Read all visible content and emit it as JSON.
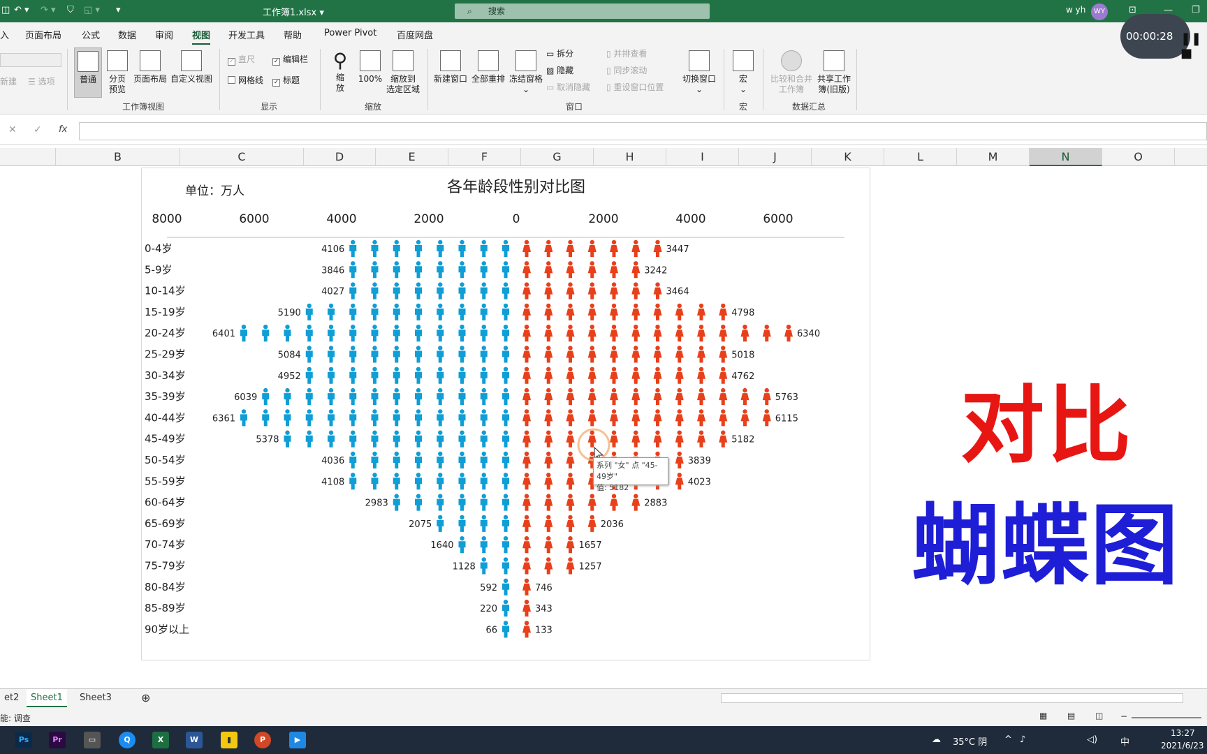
{
  "window": {
    "filename": "工作簿1.xlsx",
    "search_placeholder": "搜索",
    "user": "w yh",
    "avatar": "WY",
    "recording_time": "00:00:28"
  },
  "menu": [
    "入",
    "页面布局",
    "公式",
    "数据",
    "审阅",
    "视图",
    "开发工具",
    "帮助",
    "Power Pivot",
    "百度网盘"
  ],
  "ribbon": {
    "left_partial": [
      "新建",
      "选项"
    ],
    "workbook_views": {
      "label": "工作簿视图",
      "items": [
        "普通",
        "分页\n预览",
        "页面布局",
        "自定义视图"
      ]
    },
    "show": {
      "label": "显示",
      "ruler": "直尺",
      "gridlines": "网格线",
      "formula_bar": "编辑栏",
      "headings": "标题"
    },
    "zoom": {
      "label": "缩放",
      "items": [
        "缩\n放",
        "100%",
        "缩放到\n选定区域"
      ]
    },
    "window": {
      "label": "窗口",
      "items": [
        "新建窗口",
        "全部重排",
        "冻结窗格"
      ],
      "small": [
        "拆分",
        "隐藏",
        "取消隐藏",
        "并排查看",
        "同步滚动",
        "重设窗口位置"
      ],
      "switch": "切换窗口"
    },
    "macro": {
      "label": "宏",
      "item": "宏"
    },
    "summary": {
      "label": "数据汇总",
      "items": [
        "比较和合并\n工作簿",
        "共享工作\n簿(旧版)"
      ]
    }
  },
  "columns": [
    "B",
    "C",
    "D",
    "E",
    "F",
    "G",
    "H",
    "I",
    "J",
    "K",
    "L",
    "M",
    "N",
    "O"
  ],
  "selected_column": "N",
  "chart_data": {
    "type": "bar",
    "title": "各年龄段性别对比图",
    "unit_label": "单位：万人",
    "axis_ticks": [
      "8000",
      "6000",
      "4000",
      "2000",
      "0",
      "2000",
      "4000",
      "6000"
    ],
    "categories": [
      "0-4岁",
      "5-9岁",
      "10-14岁",
      "15-19岁",
      "20-24岁",
      "25-29岁",
      "30-34岁",
      "35-39岁",
      "40-44岁",
      "45-49岁",
      "50-54岁",
      "55-59岁",
      "60-64岁",
      "65-69岁",
      "70-74岁",
      "75-79岁",
      "80-84岁",
      "85-89岁",
      "90岁以上"
    ],
    "series": [
      {
        "name": "男",
        "color": "#0f9ed5",
        "values": [
          4106,
          3846,
          4027,
          5190,
          6401,
          5084,
          4952,
          6039,
          6361,
          5378,
          4036,
          4108,
          2983,
          2075,
          1640,
          1128,
          592,
          220,
          66
        ]
      },
      {
        "name": "女",
        "color": "#e8401b",
        "values": [
          3447,
          3242,
          3464,
          4798,
          6340,
          5018,
          4762,
          5763,
          6115,
          5182,
          3839,
          4023,
          2883,
          2036,
          1657,
          1257,
          746,
          343,
          133
        ]
      }
    ],
    "icon_unit": 500
  },
  "tooltip": {
    "line1": "系列 \"女\" 点 \"45-49岁\"",
    "line2": "值: 5182"
  },
  "overlay": {
    "text1": "对比",
    "text2": "蝴蝶图"
  },
  "sheets": [
    "et2",
    "Sheet1",
    "Sheet3"
  ],
  "active_sheet": "Sheet1",
  "status": "能: 调查",
  "taskbar": {
    "weather": "35°C 阴",
    "ime": "中",
    "time": "13:27",
    "date": "2021/6/23"
  }
}
